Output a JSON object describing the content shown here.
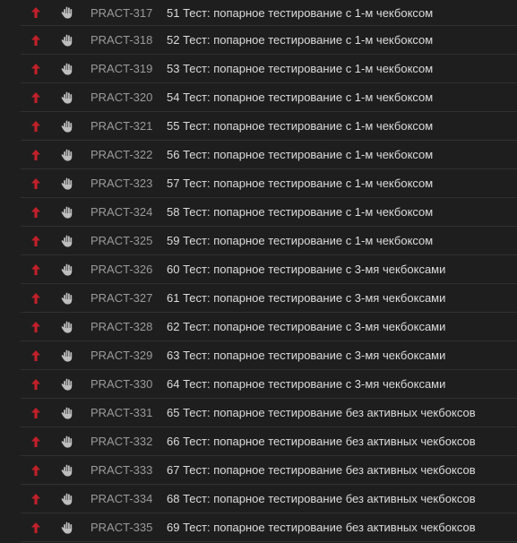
{
  "colors": {
    "background": "#1e1e1e",
    "row_divider": "#303030",
    "priority_arrow": "#c0202a",
    "drag_icon": "#bdbdbd",
    "key_text": "#9a9a9a",
    "title_text": "#dcdcdc"
  },
  "icons": {
    "priority": "arrow-up-icon",
    "drag": "hand-icon"
  },
  "issues": [
    {
      "key": "PRACT-317",
      "title": "51 Тест: попарное тестирование с 1-м чекбоксом"
    },
    {
      "key": "PRACT-318",
      "title": "52 Тест: попарное тестирование с 1-м чекбоксом"
    },
    {
      "key": "PRACT-319",
      "title": "53 Тест: попарное тестирование с 1-м чекбоксом"
    },
    {
      "key": "PRACT-320",
      "title": "54 Тест: попарное тестирование с 1-м чекбоксом"
    },
    {
      "key": "PRACT-321",
      "title": "55 Тест: попарное тестирование с 1-м чекбоксом"
    },
    {
      "key": "PRACT-322",
      "title": "56 Тест: попарное тестирование с 1-м чекбоксом"
    },
    {
      "key": "PRACT-323",
      "title": "57 Тест: попарное тестирование с 1-м чекбоксом"
    },
    {
      "key": "PRACT-324",
      "title": "58 Тест: попарное тестирование с 1-м чекбоксом"
    },
    {
      "key": "PRACT-325",
      "title": "59 Тест: попарное тестирование с 1-м чекбоксом"
    },
    {
      "key": "PRACT-326",
      "title": "60 Тест: попарное тестирование с 3-мя чекбоксами"
    },
    {
      "key": "PRACT-327",
      "title": "61 Тест: попарное тестирование с 3-мя чекбоксами"
    },
    {
      "key": "PRACT-328",
      "title": "62 Тест: попарное тестирование с 3-мя чекбоксами"
    },
    {
      "key": "PRACT-329",
      "title": "63 Тест: попарное тестирование с 3-мя чекбоксами"
    },
    {
      "key": "PRACT-330",
      "title": "64 Тест: попарное тестирование с 3-мя чекбоксами"
    },
    {
      "key": "PRACT-331",
      "title": "65 Тест: попарное тестирование без активных чекбоксов"
    },
    {
      "key": "PRACT-332",
      "title": "66 Тест: попарное тестирование без активных чекбоксов"
    },
    {
      "key": "PRACT-333",
      "title": "67 Тест: попарное тестирование без активных чекбоксов"
    },
    {
      "key": "PRACT-334",
      "title": "68 Тест: попарное тестирование без активных чекбоксов"
    },
    {
      "key": "PRACT-335",
      "title": "69 Тест: попарное тестирование без активных чекбоксов"
    }
  ]
}
